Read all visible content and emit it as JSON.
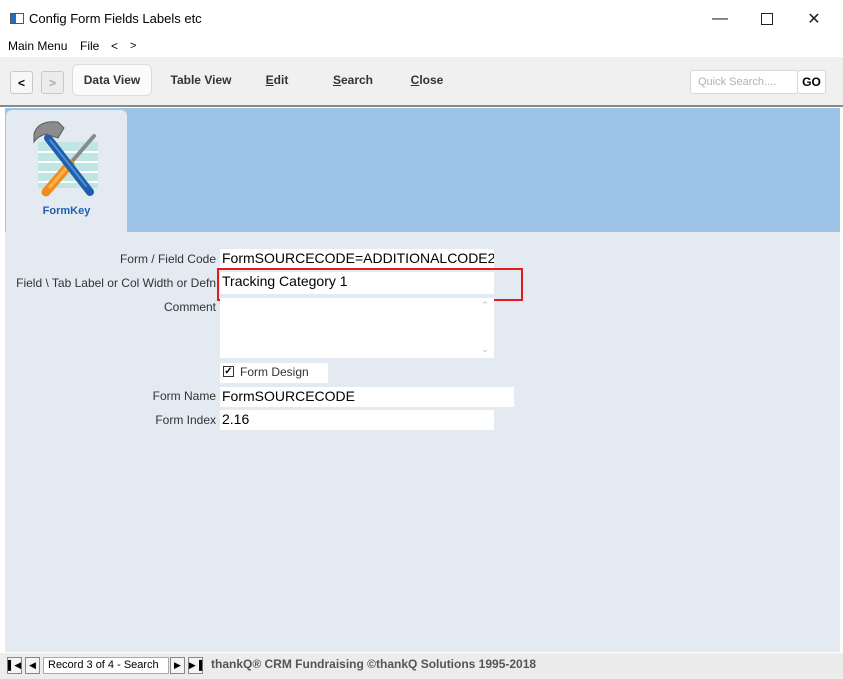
{
  "window": {
    "title": "Config Form Fields Labels etc"
  },
  "menu": {
    "items": [
      "Main Menu",
      "File",
      "<",
      ">"
    ]
  },
  "toolbar": {
    "back": "<",
    "forward": ">",
    "data_view": "Data View",
    "table_view": "Table View",
    "edit": "Edit",
    "search": "Search",
    "close": "Close",
    "quick_search_placeholder": "Quick Search....",
    "go": "GO"
  },
  "tab": {
    "label": "FormKey",
    "icon": "tools-icon"
  },
  "form": {
    "code_label": "Form / Field Code",
    "code_value": "FormSOURCECODE=ADDITIONALCODE2",
    "tab_label": "Field \\ Tab Label or Col Width or Defn",
    "tab_value": "Tracking Category 1",
    "comment_label": "Comment",
    "comment_value": "",
    "form_design_label": "Form Design",
    "form_design_checked": true,
    "form_name_label": "Form Name",
    "form_name_value": "FormSOURCECODE",
    "form_index_label": "Form Index",
    "form_index_value": "2.16"
  },
  "status": {
    "record": "Record 3 of 4 - Search",
    "copyright": "thankQ® CRM Fundraising ©thankQ Solutions 1995-2018"
  },
  "colors": {
    "header_blue": "#9dc3e6",
    "panel": "#e3eaf1",
    "highlight": "#e41b1b",
    "tab_label": "#1f5fae"
  }
}
